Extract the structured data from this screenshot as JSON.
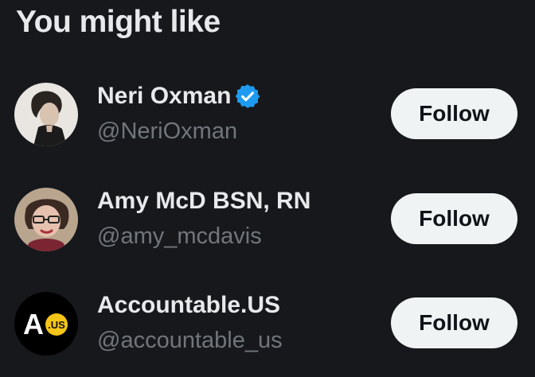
{
  "section": {
    "title": "You might like"
  },
  "suggestions": [
    {
      "name": "Neri Oxman",
      "handle": "@NeriOxman",
      "verified": true,
      "avatar_icon": "portrait-photo",
      "button_label": "Follow"
    },
    {
      "name": "Amy McD BSN, RN",
      "handle": "@amy_mcdavis",
      "verified": false,
      "avatar_icon": "portrait-photo",
      "button_label": "Follow"
    },
    {
      "name": "Accountable.US",
      "handle": "@accountable_us",
      "verified": false,
      "avatar_icon": "logo",
      "avatar_logo_text": "A",
      "avatar_logo_badge": ".US",
      "button_label": "Follow"
    }
  ],
  "colors": {
    "background": "#16181c",
    "primary_text": "#e7e9ea",
    "secondary_text": "#71767b",
    "button_bg": "#eff3f4",
    "button_text": "#0f1419",
    "verified": "#1d9bf0",
    "logo_badge": "#f5c518"
  }
}
